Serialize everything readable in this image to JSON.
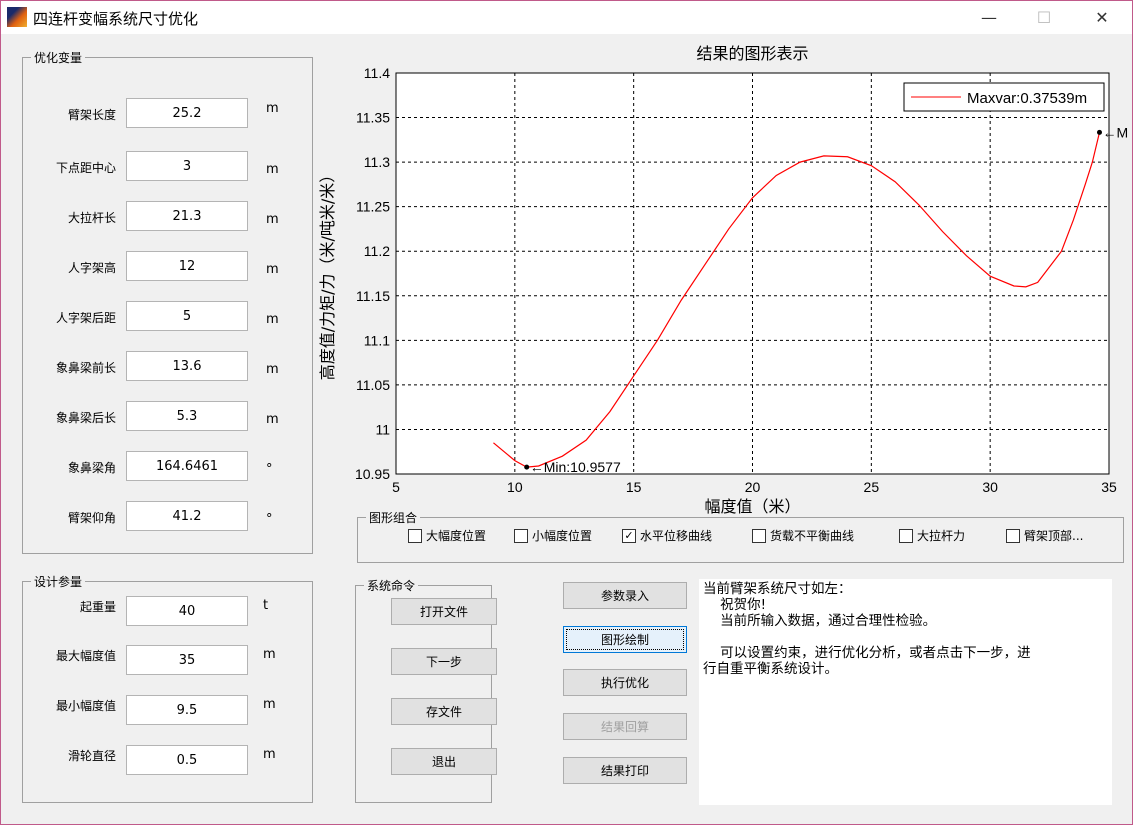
{
  "window": {
    "title": "四连杆变幅系统尺寸优化",
    "minimize": "—",
    "maximize": "☐",
    "close": "✕"
  },
  "opt_vars": {
    "legend": "优化变量",
    "rows": [
      {
        "label": "臂架长度",
        "value": "25.2",
        "unit": "m"
      },
      {
        "label": "下点距中心",
        "value": "3",
        "unit": "m"
      },
      {
        "label": "大拉杆长",
        "value": "21.3",
        "unit": "m"
      },
      {
        "label": "人字架高",
        "value": "12",
        "unit": "m"
      },
      {
        "label": "人字架后距",
        "value": "5",
        "unit": "m"
      },
      {
        "label": "象鼻梁前长",
        "value": "13.6",
        "unit": "m"
      },
      {
        "label": "象鼻梁后长",
        "value": "5.3",
        "unit": "m"
      },
      {
        "label": "象鼻梁角",
        "value": "164.6461",
        "unit": "°"
      },
      {
        "label": "臂架仰角",
        "value": "41.2",
        "unit": "°"
      }
    ]
  },
  "design_params": {
    "legend": "设计参量",
    "rows": [
      {
        "label": "起重量",
        "value": "40",
        "unit": "t"
      },
      {
        "label": "最大幅度值",
        "value": "35",
        "unit": "m"
      },
      {
        "label": "最小幅度值",
        "value": "9.5",
        "unit": "m"
      },
      {
        "label": "滑轮直径",
        "value": "0.5",
        "unit": "m"
      }
    ]
  },
  "plot_group": {
    "legend": "图形组合",
    "items": [
      {
        "label": "大幅度位置",
        "checked": false
      },
      {
        "label": "小幅度位置",
        "checked": false
      },
      {
        "label": "水平位移曲线",
        "checked": true
      },
      {
        "label": "货载不平衡曲线",
        "checked": false
      },
      {
        "label": "大拉杆力",
        "checked": false
      },
      {
        "label": "臂架顶部...",
        "checked": false
      }
    ]
  },
  "commands": {
    "legend": "系统命令",
    "buttons": [
      "打开文件",
      "下一步",
      "存文件",
      "退出"
    ]
  },
  "actions": {
    "buttons": [
      "参数录入",
      "图形绘制",
      "执行优化",
      "结果回算",
      "结果打印"
    ]
  },
  "message": "当前臂架系统尺寸如左：\n    祝贺你!\n    当前所输入数据，通过合理性检验。\n\n    可以设置约束，进行优化分析，或者点击下一步，进\n行自重平衡系统设计。",
  "chart_data": {
    "type": "line",
    "title": "结果的图形表示",
    "xlabel": "幅度值（米）",
    "ylabel": "高度值/力矩/力（米/吨米/米）",
    "xlim": [
      5,
      35
    ],
    "ylim": [
      10.95,
      11.4
    ],
    "grid": true,
    "xticks": [
      "5",
      "10",
      "15",
      "20",
      "25",
      "30",
      "35"
    ],
    "yticks": [
      "10.95",
      "11",
      "11.05",
      "11.1",
      "11.15",
      "11.2",
      "11.25",
      "11.3",
      "11.35",
      "11.4"
    ],
    "legend": {
      "label": "Maxvar:0.37539m",
      "placement": "top-right"
    },
    "series": [
      {
        "name": "Maxvar:0.37539m",
        "color": "#ff0000",
        "x": [
          9.1,
          10,
          10.5,
          11,
          12,
          13,
          14,
          15,
          16,
          17,
          18,
          19,
          20,
          21,
          22,
          23,
          24,
          25,
          26,
          27,
          28,
          29,
          30,
          31,
          31.5,
          32,
          33,
          33.5,
          34,
          34.3,
          34.6
        ],
        "y": [
          10.985,
          10.965,
          10.9577,
          10.959,
          10.97,
          10.988,
          11.02,
          11.06,
          11.1,
          11.145,
          11.185,
          11.225,
          11.26,
          11.285,
          11.3,
          11.307,
          11.306,
          11.296,
          11.278,
          11.252,
          11.222,
          11.195,
          11.172,
          11.161,
          11.16,
          11.165,
          11.2,
          11.235,
          11.275,
          11.3,
          11.3334
        ]
      }
    ],
    "annotations": [
      {
        "text": "←Min:10.9577",
        "x": 10.5,
        "y": 10.9577
      },
      {
        "text": "←M",
        "x": 34.6,
        "y": 11.3334
      }
    ]
  }
}
